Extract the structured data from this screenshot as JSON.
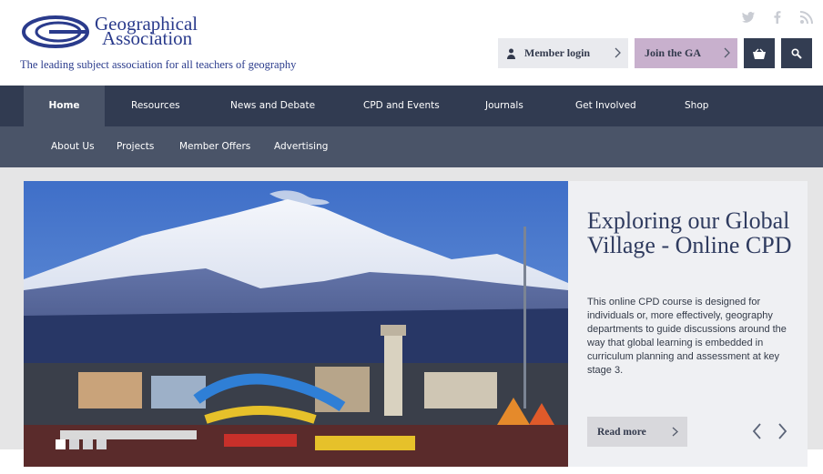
{
  "header": {
    "logo_line1": "Geographical",
    "logo_line2": "Association",
    "tagline": "The leading subject association for all teachers of geography",
    "social_icons": [
      "twitter-icon",
      "facebook-icon",
      "rss-icon"
    ],
    "member_login_label": "Member login",
    "join_label": "Join the GA"
  },
  "nav": {
    "primary": [
      "Home",
      "Resources",
      "News and Debate",
      "CPD and Events",
      "Journals",
      "Get Involved",
      "Shop"
    ],
    "active": "Home",
    "secondary": [
      "About Us",
      "Projects",
      "Member Offers",
      "Advertising"
    ]
  },
  "hero": {
    "title": "Exploring our Global Village - Online CPD",
    "body": "This online CPD course is designed for individuals or, more effectively, geography departments to guide discussions around the way that global learning is embedded in curriculum planning and assessment at key stage 3.",
    "read_more_label": "Read more",
    "slides_total": 4,
    "slide_active": 1
  },
  "colors": {
    "brand_blue": "#2a3b8c",
    "nav_dark": "#313b51",
    "nav_mid": "#4a5468",
    "join_purple": "#c8b0cd"
  }
}
